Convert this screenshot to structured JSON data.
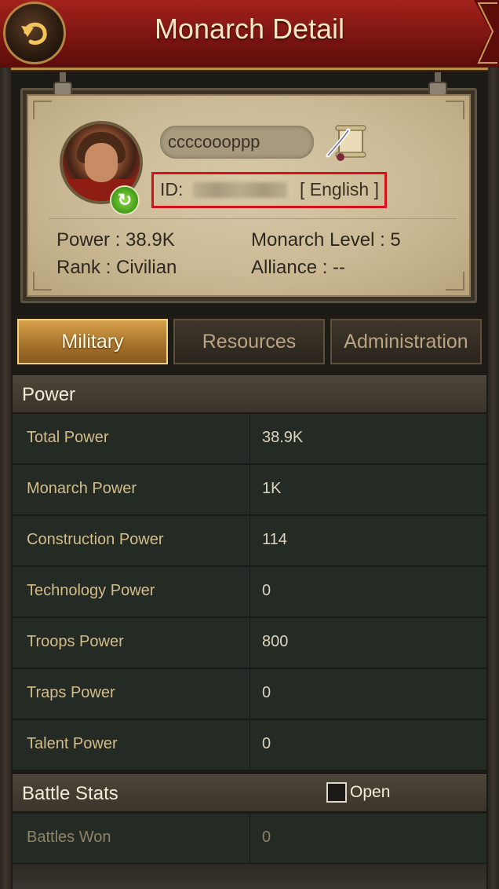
{
  "header": {
    "title": "Monarch Detail"
  },
  "profile": {
    "name": "ccccoooppp",
    "id_label": "ID:",
    "language": "[ English ]",
    "power": "Power : 38.9K",
    "monarch_level": "Monarch Level : 5",
    "rank": "Rank : Civilian",
    "alliance": "Alliance :   --"
  },
  "tabs": [
    {
      "label": "Military",
      "active": true
    },
    {
      "label": "Resources",
      "active": false
    },
    {
      "label": "Administration",
      "active": false
    }
  ],
  "power_section": {
    "title": "Power",
    "rows": [
      {
        "label": "Total Power",
        "value": "38.9K"
      },
      {
        "label": "Monarch Power",
        "value": "1K"
      },
      {
        "label": "Construction Power",
        "value": "114"
      },
      {
        "label": "Technology Power",
        "value": "0"
      },
      {
        "label": "Troops Power",
        "value": "800"
      },
      {
        "label": "Traps Power",
        "value": "0"
      },
      {
        "label": "Talent Power",
        "value": "0"
      }
    ]
  },
  "battle_section": {
    "title": "Battle Stats",
    "open_label": "Open",
    "rows": [
      {
        "label": "Battles Won",
        "value": "0"
      }
    ]
  },
  "colors": {
    "header_red": "#8e1a14",
    "gold_accent": "#b8904c",
    "highlight_red": "#d6111b",
    "active_tab": "#c08a3a"
  },
  "icons": {
    "back": "back-arrow-icon",
    "letter": "scroll-quill-icon",
    "refresh": "refresh-icon"
  }
}
